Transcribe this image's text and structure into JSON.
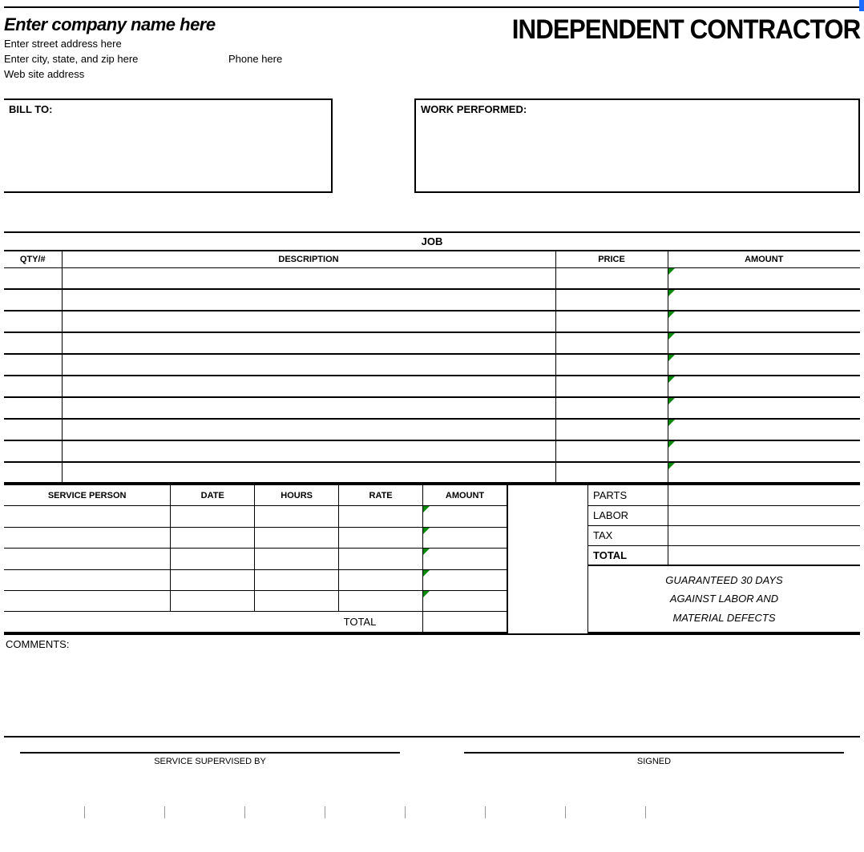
{
  "header": {
    "company_name": "Enter company name here",
    "street": "Enter street address here",
    "city_state_zip": "Enter city, state, and zip here",
    "phone": "Phone here",
    "website": "Web site address",
    "title": "INDEPENDENT CONTRACTOR"
  },
  "boxes": {
    "bill_to_label": "BILL TO:",
    "work_performed_label": "WORK PERFORMED:"
  },
  "job": {
    "title": "JOB",
    "headers": {
      "qty": "QTY/#",
      "desc": "DESCRIPTION",
      "price": "PRICE",
      "amount": "AMOUNT"
    },
    "row_count": 10
  },
  "service": {
    "headers": {
      "person": "SERVICE PERSON",
      "date": "DATE",
      "hours": "HOURS",
      "rate": "RATE",
      "amount": "AMOUNT"
    },
    "row_count": 5,
    "total_label": "TOTAL"
  },
  "totals": {
    "parts": "PARTS",
    "labor": "LABOR",
    "tax": "TAX",
    "total": "TOTAL"
  },
  "guarantee": {
    "line1": "GUARANTEED 30 DAYS",
    "line2": "AGAINST LABOR AND",
    "line3": "MATERIAL DEFECTS"
  },
  "comments_label": "COMMENTS:",
  "signatures": {
    "supervised": "SERVICE SUPERVISED BY",
    "signed": "SIGNED"
  }
}
